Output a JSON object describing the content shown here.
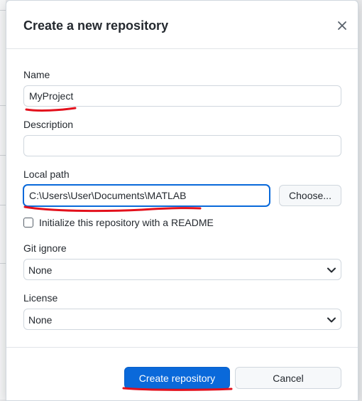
{
  "dialog": {
    "title": "Create a new repository",
    "close_icon": "close-icon"
  },
  "form": {
    "name": {
      "label": "Name",
      "value": "MyProject"
    },
    "description": {
      "label": "Description",
      "value": ""
    },
    "local_path": {
      "label": "Local path",
      "value": "C:\\Users\\User\\Documents\\MATLAB",
      "choose_label": "Choose..."
    },
    "readme": {
      "label": "Initialize this repository with a README",
      "checked": false
    },
    "git_ignore": {
      "label": "Git ignore",
      "selected": "None"
    },
    "license": {
      "label": "License",
      "selected": "None"
    }
  },
  "footer": {
    "create_label": "Create repository",
    "cancel_label": "Cancel"
  },
  "colors": {
    "primary": "#0a69da",
    "focus": "#0969da",
    "annotation": "#e3101c"
  }
}
